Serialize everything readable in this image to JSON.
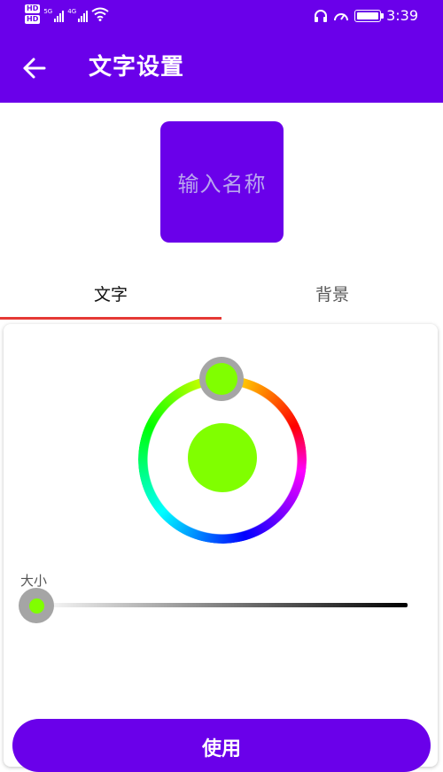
{
  "status_bar": {
    "hd_badge_1": "HD",
    "hd_badge_2": "HD",
    "network_1": "5G",
    "network_2": "4G",
    "time": "3:39"
  },
  "app_bar": {
    "title": "文字设置",
    "back_icon": "arrow-left-icon"
  },
  "preview": {
    "placeholder_text": "输入名称",
    "background_color": "#6a00ea"
  },
  "tabs": [
    {
      "label": "文字",
      "selected": true
    },
    {
      "label": "背景",
      "selected": false
    }
  ],
  "color_picker": {
    "selected_color": "#80ff00"
  },
  "size_slider": {
    "label": "大小",
    "value_fraction": 0.0
  },
  "action": {
    "use_label": "使用"
  },
  "colors": {
    "primary": "#6a00ea",
    "tab_indicator": "#e53935"
  }
}
